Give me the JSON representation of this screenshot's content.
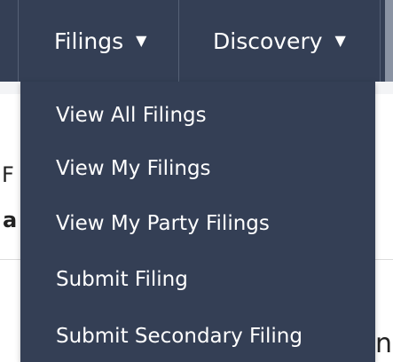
{
  "nav": {
    "items": [
      {
        "label": "Filings",
        "caret": "▼"
      },
      {
        "label": "Discovery",
        "caret": "▼"
      }
    ]
  },
  "dropdown": {
    "items": [
      {
        "label": "View All Filings"
      },
      {
        "label": "View My Filings"
      },
      {
        "label": "View My Party Filings"
      },
      {
        "label": "Submit Filing"
      },
      {
        "label": "Submit Secondary Filing"
      }
    ]
  },
  "background": {
    "fragment_1": "F",
    "fragment_2": "a",
    "fragment_3": "ni"
  },
  "colors": {
    "navbar": "#343f55",
    "dropdown": "#343f55",
    "text": "#ffffff"
  }
}
